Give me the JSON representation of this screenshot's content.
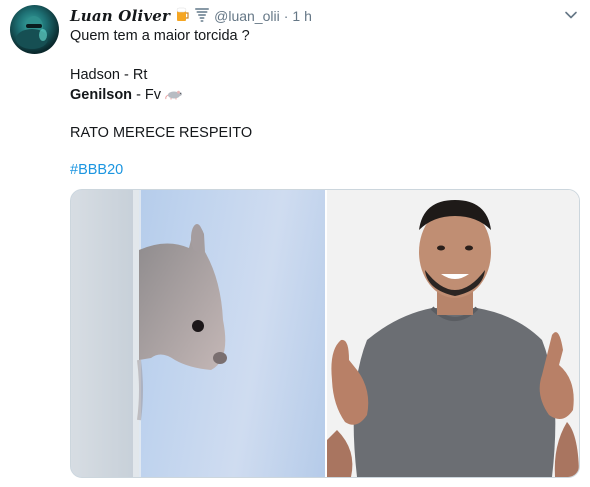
{
  "author": {
    "display_name": "Luan Oliver",
    "emoji_icons": [
      "beer-glass-icon",
      "tornado-icon"
    ],
    "handle": "@luan_olii",
    "separator": "·",
    "timestamp": "1 h"
  },
  "tweet": {
    "line1": "Quem tem a maior torcida ?",
    "line2": "Hadson - Rt",
    "line3_name": "Genilson",
    "line3_rest": " - Fv ",
    "line3_icon": "rat-icon",
    "line4": "RATO MERECE RESPEITO",
    "hashtag": "#BBB20"
  },
  "media": {
    "left_image": "rat-peeking-photo",
    "right_image": "man-grey-shirt-thumbs-photo"
  },
  "colors": {
    "text": "#14171a",
    "secondary": "#657786",
    "link": "#1b95e0",
    "border": "#ccd6dd"
  }
}
